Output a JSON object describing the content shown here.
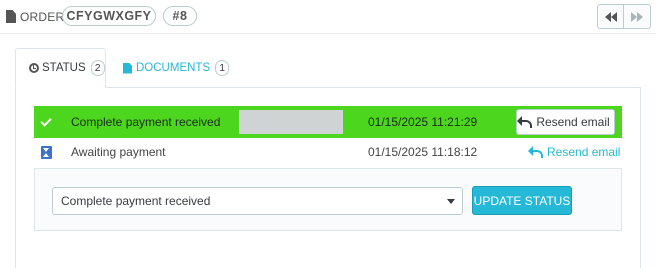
{
  "header": {
    "order_label": "Order",
    "order_reference": "CFYGWXGFY",
    "order_number": "#8"
  },
  "tabs": [
    {
      "label": "Status",
      "count": "2",
      "icon": "clock-icon"
    },
    {
      "label": "Documents",
      "count": "1",
      "icon": "file-icon"
    }
  ],
  "history": [
    {
      "status": "Complete payment received",
      "date": "01/15/2025 11:21:29",
      "action": "Resend email",
      "icon": "check-icon",
      "background": "#4cd61d"
    },
    {
      "status": "Awaiting payment",
      "date": "01/15/2025 11:18:12",
      "action": "Resend email",
      "icon": "hourglass-icon"
    }
  ],
  "status_form": {
    "selected": "Complete payment received",
    "submit_label": "Update status"
  },
  "colors": {
    "accent": "#25b9d7",
    "success": "#4cd61d"
  }
}
